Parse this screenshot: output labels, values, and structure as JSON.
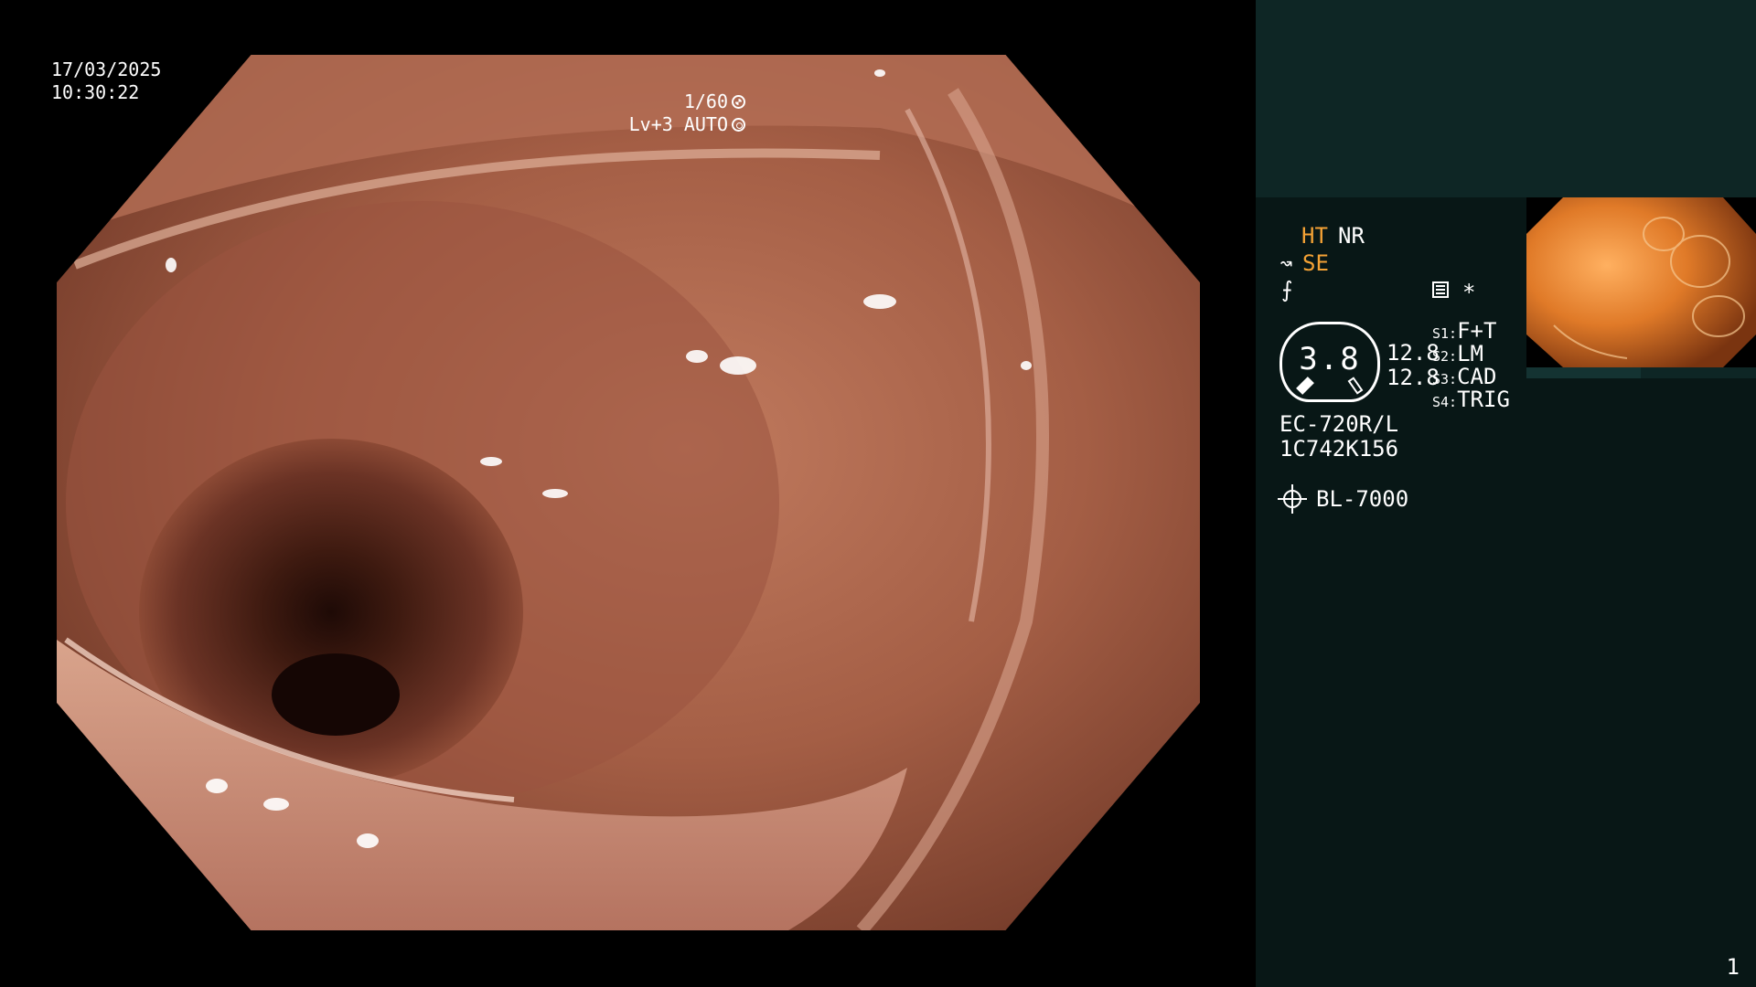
{
  "overlay": {
    "date": "17/03/2025",
    "time": "10:30:22",
    "shutter": "1/60",
    "iris": "Lv+3 AUTO"
  },
  "sidebar": {
    "ht": "HT",
    "nr": "NR",
    "se_icon": "↝",
    "se": "SE",
    "f_icon": "⨍",
    "star": "*",
    "gauge_value": "3.8",
    "gauge_val1": "12.8",
    "gauge_val2": "12.8",
    "switches": [
      {
        "key": "S1:",
        "label": "F+T"
      },
      {
        "key": "S2:",
        "label": "LM"
      },
      {
        "key": "S3:",
        "label": "CAD"
      },
      {
        "key": "S4:",
        "label": "TRIG"
      }
    ],
    "scope_model": "EC-720R/L",
    "scope_serial": "1C742K156",
    "light_model": "BL-7000",
    "page_number": "1"
  },
  "colors": {
    "sidebar_bg": "#081716",
    "sidebar_top_bg": "#0e2625",
    "accent_orange": "#f4a235"
  },
  "icons": {
    "shutter": "shutter-ring-icon",
    "iris": "iris-ring-icon",
    "menu": "menu-list-icon",
    "light": "light-source-icon",
    "gauge": "scope-gauge-icon"
  }
}
